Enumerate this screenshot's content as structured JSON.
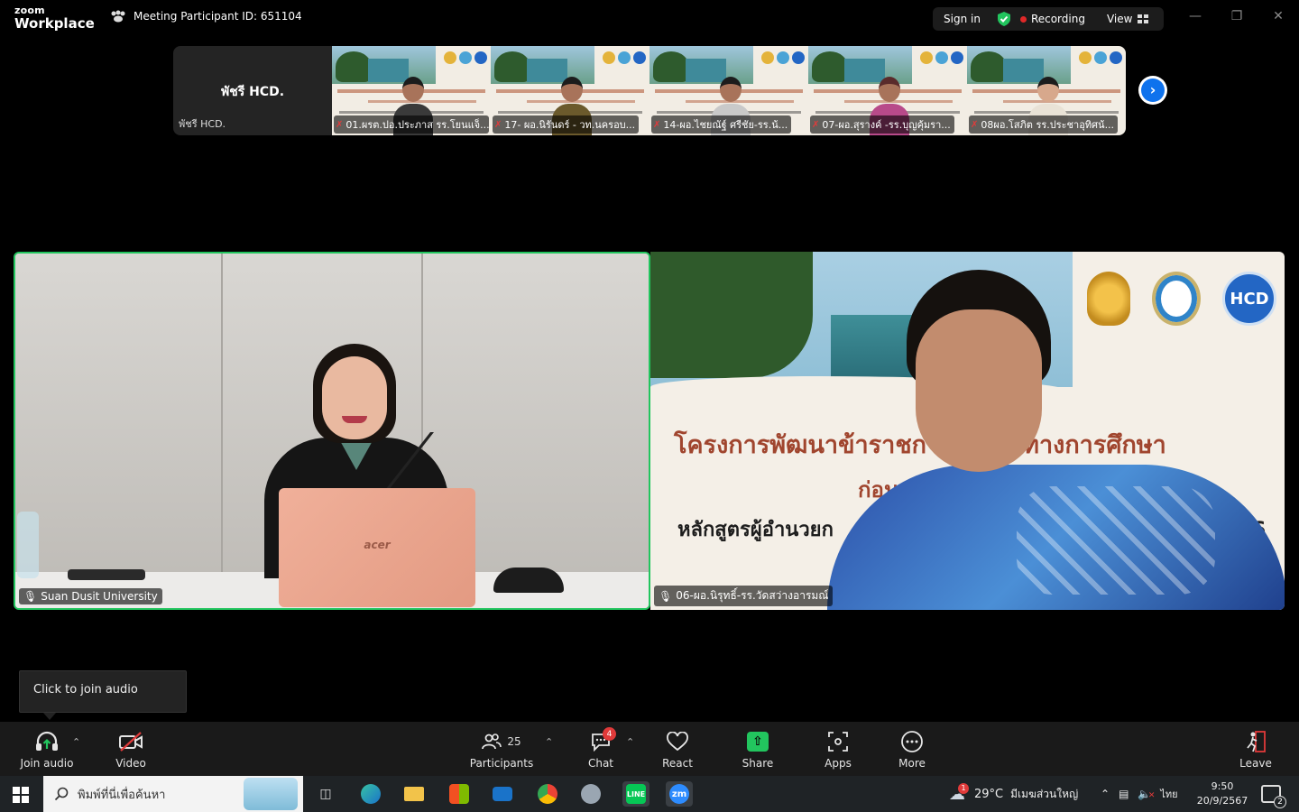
{
  "app": {
    "brand_top": "zoom",
    "brand_bottom": "Workplace",
    "meeting_id_label": "Meeting Participant ID: 651104",
    "sign_in": "Sign in",
    "recording": "Recording",
    "view": "View"
  },
  "thumbnails": {
    "name_tile": {
      "big": "พัชรี HCD.",
      "small": "พัชรี HCD."
    },
    "tiles": [
      {
        "label": "01.ผรต.ปอ.ประภาส รร.โยนแจ็..."
      },
      {
        "label": "17- ผอ.นิรันดร์ - วท.นครอบ..."
      },
      {
        "label": "14-ผอ.ไชยณัฐ์ ศรีชัย-รร.น้..."
      },
      {
        "label": "07-ผอ.สุรางค์ -รร.บุญคุ้มรา..."
      },
      {
        "label": "08ผอ.โสภิต  รร.ประชาอุทิศน้..."
      }
    ]
  },
  "videos": {
    "left": {
      "label": "Suan Dusit University",
      "laptop_brand": "acer"
    },
    "right": {
      "label": "06-ผอ.นิรุทธิ์-รร.วัดสว่างอารมณ์",
      "banner": {
        "line1": "โครงการพัฒนาข้าราชก      บุคลากรทางการศึกษา",
        "line2": "ก่อน        เป็นวิทยฐานะ",
        "line3": "หลักสูตรผู้อำนวยก",
        "line4": "ที่ 146",
        "logo_text": "HCD"
      }
    }
  },
  "tooltip": {
    "text": "Click to join audio"
  },
  "toolbar": {
    "join_audio": "Join audio",
    "video": "Video",
    "participants": "Participants",
    "participants_count": "25",
    "chat": "Chat",
    "chat_badge": "4",
    "react": "React",
    "share": "Share",
    "apps": "Apps",
    "more": "More",
    "leave": "Leave"
  },
  "taskbar": {
    "search_placeholder": "พิมพ์ที่นี่เพื่อค้นหา",
    "weather_temp": "29°C",
    "weather_text": "มีเมฆส่วนใหญ่",
    "weather_badge": "1",
    "lang": "ไทย",
    "time": "9:50",
    "date": "20/9/2567",
    "notif_count": "2",
    "zoom_app": "zm"
  },
  "colors": {
    "accent_green": "#22c55e",
    "zoom_blue": "#0e72ed",
    "recording_red": "#e02828",
    "toolbar_bg": "#1a1a1a"
  }
}
